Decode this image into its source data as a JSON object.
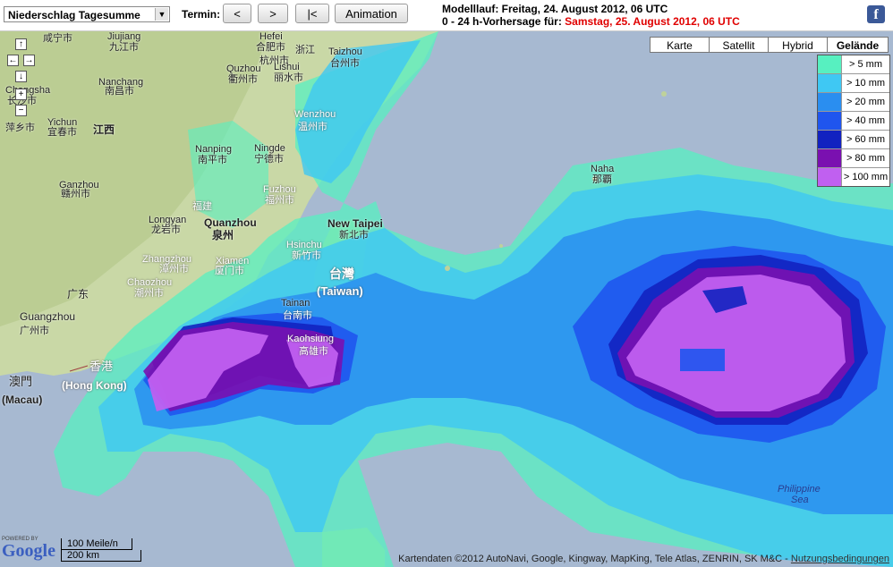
{
  "toolbar": {
    "product_select": "Niederschlag Tagesumme",
    "termin_label": "Termin:",
    "prev_label": "<",
    "next_label": ">",
    "first_label": "|<",
    "animation_label": "Animation",
    "modelllauf": "Modelllauf: Freitag, 24. August 2012, 06 UTC",
    "forecast_prefix": "0 - 24 h-Vorhersage für:",
    "forecast_date": "Samstag, 25. August 2012, 06 UTC",
    "facebook": "f"
  },
  "map_types": [
    "Karte",
    "Satellit",
    "Hybrid",
    "Gelände"
  ],
  "active_map_type": "Gelände",
  "legend": [
    {
      "label": "> 5 mm",
      "color": "#57f0c0"
    },
    {
      "label": "> 10 mm",
      "color": "#3fc8f3"
    },
    {
      "label": "> 20 mm",
      "color": "#2a8ef0"
    },
    {
      "label": "> 40 mm",
      "color": "#1f55ee"
    },
    {
      "label": "> 60 mm",
      "color": "#1222c0"
    },
    {
      "label": "> 80 mm",
      "color": "#7a10b0"
    },
    {
      "label": "> 100 mm",
      "color": "#c060f0"
    }
  ],
  "places": {
    "p1": "咸宁市",
    "p2": "Jiujiang",
    "p3": "九江市",
    "p4": "Hefei",
    "p5": "合肥市",
    "p6": "杭州市",
    "p7": "浙江",
    "p8": "Taizhou",
    "p9": "台州市",
    "p10": "Quzhou",
    "p11": "衢州市",
    "p12": "Lishui",
    "p13": "丽水市",
    "p14": "Nanchang",
    "p15": "南昌市",
    "p16": "Changsha",
    "p17": "长沙市",
    "p18": "Yichun",
    "p19": "宜春市",
    "p20": "萍乡市",
    "p21": "江西",
    "p22": "Wenzhou",
    "p23": "温州市",
    "p24": "Nanping",
    "p25": "南平市",
    "p26": "Ningde",
    "p27": "宁德市",
    "p28": "Fuzhou",
    "p29": "福州市",
    "p30": "Naha",
    "p31": "那覇",
    "p32": "Ganzhou",
    "p33": "赣州市",
    "p34": "Longyan",
    "p35": "龙岩市",
    "p36": "福建",
    "p37": "Quanzhou",
    "p38": "泉州",
    "p39": "New Taipei",
    "p40": "新北市",
    "p41": "Hsinchu",
    "p42": "新竹市",
    "p43": "Zhangzhou",
    "p44": "漳州市",
    "p45": "Xiamen",
    "p46": "厦门市",
    "p47": "台灣",
    "p48": "(Taiwan)",
    "p49": "Chaozhou",
    "p50": "潮州市",
    "p51": "广东",
    "p52": "Tainan",
    "p53": "台南市",
    "p54": "Guangzhou",
    "p55": "广州市",
    "p56": "Kaohsiung",
    "p57": "高雄市",
    "p58": "香港",
    "p59": "(Hong Kong)",
    "p60": "澳門",
    "p61": "(Macau)",
    "p62": "Philippine",
    "p63": "Sea"
  },
  "scale": {
    "miles": "100 Meile/n",
    "km": "200 km"
  },
  "google": {
    "powered": "POWERED BY",
    "word": "Google"
  },
  "copyright": "Kartendaten ©2012 AutoNavi, Google, Kingway, MapKing, Tele Atlas, ZENRIN, SK M&C -",
  "terms": "Nutzungsbedingungen"
}
